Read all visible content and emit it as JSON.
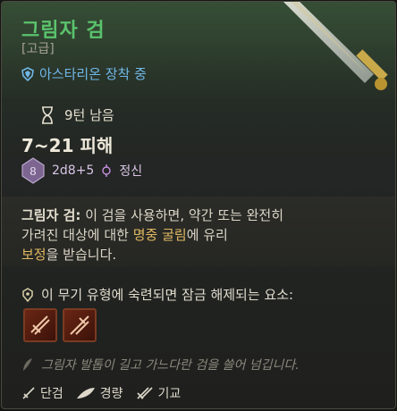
{
  "item": {
    "name": "그림자 검",
    "rarity": "[고급]",
    "equipped": "아스타리온 장착 중",
    "turns_left": "9턴 남음",
    "damage": "7~21 피해",
    "dice_face": "8",
    "dice_formula": "2d8+5",
    "dice_stat": "정신"
  },
  "description": {
    "name_label": "그림자 검:",
    "text_1": " 이 검을 사용하면, 약간 또는 완전히 가려진 대상에 대한 ",
    "highlight": "명중 굴림",
    "text_2": "에 유리",
    "highlight_2": "보정",
    "text_3": "을 받습니다."
  },
  "proficiency": {
    "label": "이 무기 유형에 숙련되면 잠금 해제되는 요소:"
  },
  "flavor": "그림자 발톱이 길고 가느다란 검을 쓸어 넘깁니다.",
  "tags": [
    {
      "label": "단검",
      "icon": "dagger-icon"
    },
    {
      "label": "경량",
      "icon": "feather-icon"
    },
    {
      "label": "기교",
      "icon": "finesse-icon"
    }
  ],
  "colors": {
    "title": "#5ac36c",
    "equip": "#6fb7e8",
    "highlight": "#e2b963"
  }
}
